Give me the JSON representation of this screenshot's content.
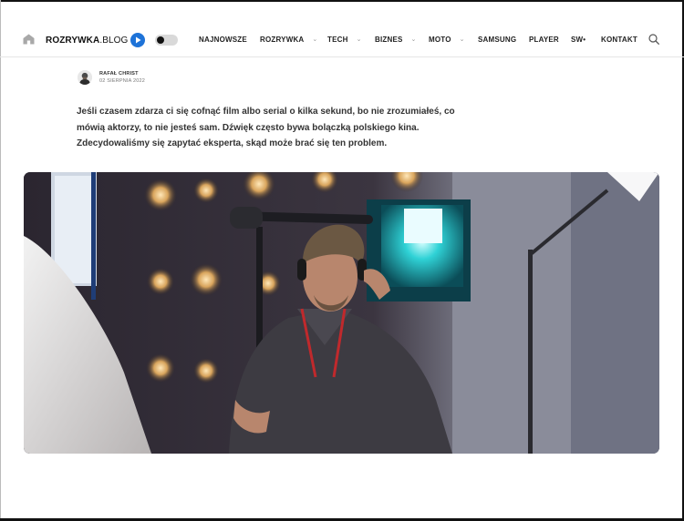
{
  "nav": {
    "logo_main": "ROZRYWKA",
    "logo_suffix": ".BLOG",
    "items": [
      {
        "label": "NAJNOWSZE",
        "has_dropdown": false
      },
      {
        "label": "ROZRYWKA",
        "has_dropdown": true
      },
      {
        "label": "TECH",
        "has_dropdown": true
      },
      {
        "label": "BIZNES",
        "has_dropdown": true
      },
      {
        "label": "MOTO",
        "has_dropdown": true
      },
      {
        "label": "SAMSUNG",
        "has_dropdown": false
      },
      {
        "label": "PLAYER",
        "has_dropdown": false
      },
      {
        "label": "SW•",
        "has_dropdown": false
      },
      {
        "label": "KONTAKT",
        "has_dropdown": false
      }
    ]
  },
  "author": {
    "name": "RAFAŁ CHRIST",
    "date": "02 SIERPNIA 2022"
  },
  "article": {
    "lead": "Jeśli czasem zdarza ci się cofnąć film albo serial o kilka sekund, bo nie zrozumiałeś, co mówią aktorzy, to nie jesteś sam. Dźwięk często bywa bolączką polskiego kina. Zdecydowaliśmy się zapytać eksperta, skąd może brać się ten problem."
  },
  "colors": {
    "accent": "#1e73d8",
    "text": "#222222",
    "border": "#e6e6e6"
  }
}
